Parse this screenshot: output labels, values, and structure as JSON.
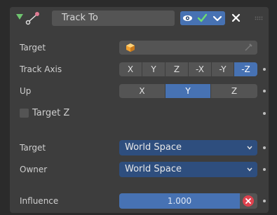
{
  "constraint": {
    "name": "Track To"
  },
  "rows": {
    "target_label": "Target",
    "track_axis_label": "Track Axis",
    "up_label": "Up",
    "target_z_label": "Target Z",
    "target_space_label": "Target",
    "owner_space_label": "Owner",
    "influence_label": "Influence"
  },
  "track_axis": {
    "options": [
      "X",
      "Y",
      "Z",
      "-X",
      "-Y",
      "-Z"
    ],
    "selected": "-Z"
  },
  "up_axis": {
    "options": [
      "X",
      "Y",
      "Z"
    ],
    "selected": "Y"
  },
  "target_z_checked": false,
  "target_space": "World Space",
  "owner_space": "World Space",
  "influence": "1.000",
  "colors": {
    "accent": "#4772b3",
    "panel": "#3d3d3d",
    "field": "#545454",
    "enabled_check": "#6fc46f",
    "clear": "#e0424e",
    "dropdown": "#2e4e7e"
  },
  "icons": {
    "collapse": "collapse-triangle-icon",
    "constraint": "track-to-constraint-icon",
    "visibility": "eye-icon",
    "enabled": "check-icon",
    "menu": "chevron-down-icon",
    "delete": "close-icon",
    "drag": "drag-grip-icon",
    "object": "object-cube-icon",
    "eyedropper": "eyedropper-icon",
    "clear_influence": "clear-x-icon"
  }
}
